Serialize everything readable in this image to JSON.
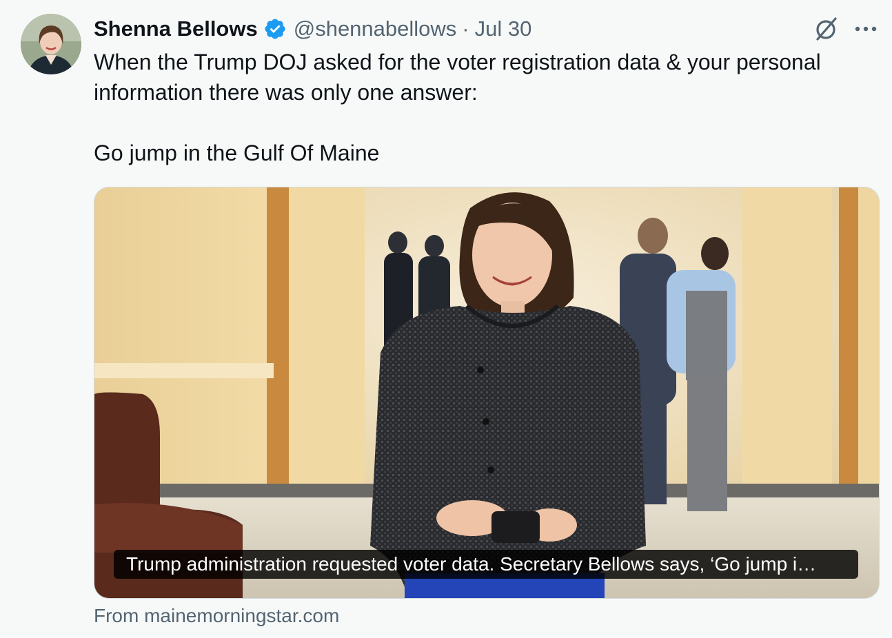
{
  "author": {
    "name": "Shenna Bellows",
    "handle": "@shennabellows",
    "separator": "·",
    "date": "Jul 30",
    "avatar_icon": "profile-photo",
    "verified_icon": "verified-badge-icon",
    "verified_color": "#1d9bf0"
  },
  "actions": {
    "grok_icon": "grok-icon",
    "more_icon": "more-icon"
  },
  "tweet": {
    "line1": "When the Trump DOJ asked for the voter registration data & your personal information there was only one answer:",
    "line2": "Go jump in the Gulf Of Maine"
  },
  "card": {
    "caption": "Trump administration requested voter data. Secretary Bellows says, ‘Go jump i…",
    "source": "From mainemorningstar.com"
  },
  "colors": {
    "text": "#0f1419",
    "secondary": "#536471",
    "background": "#f7f9f9",
    "border": "#cfd9de"
  }
}
